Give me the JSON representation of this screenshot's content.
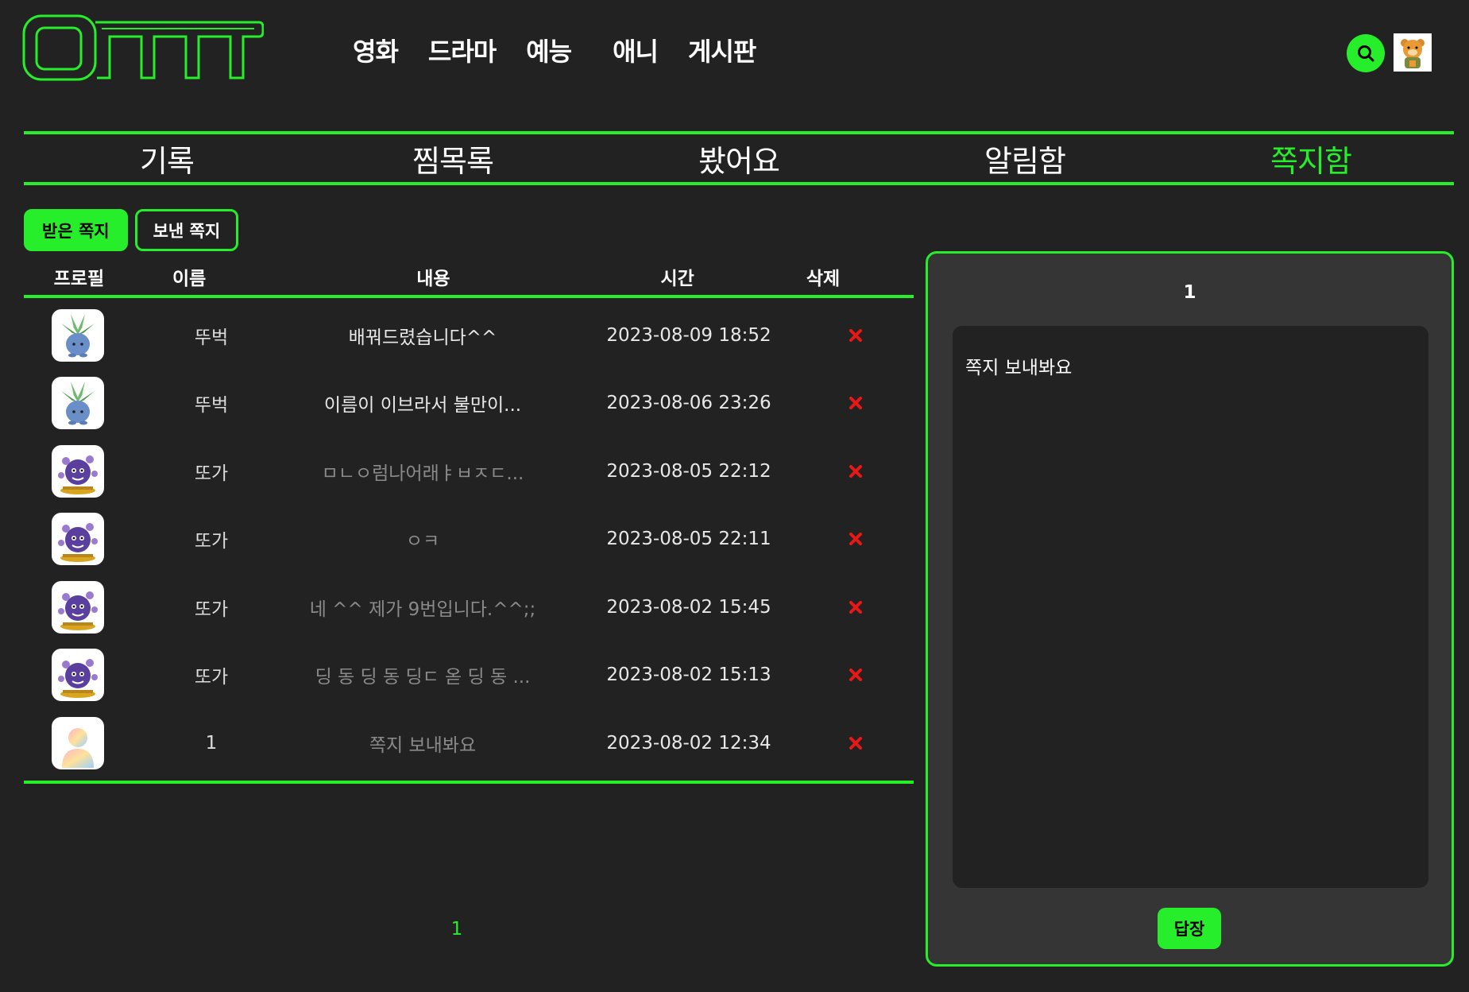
{
  "nav": {
    "items": [
      "영화",
      "드라마",
      "예능",
      "애니",
      "게시판"
    ]
  },
  "tabs": [
    {
      "label": "기록",
      "active": false
    },
    {
      "label": "찜목록",
      "active": false
    },
    {
      "label": "봤어요",
      "active": false
    },
    {
      "label": "알림함",
      "active": false
    },
    {
      "label": "쪽지함",
      "active": true
    }
  ],
  "subtabs": {
    "received": "받은 쪽지",
    "sent": "보낸 쪽지"
  },
  "table": {
    "headers": {
      "profile": "프로필",
      "name": "이름",
      "content": "내용",
      "time": "시간",
      "delete": "삭제"
    },
    "rows": [
      {
        "avatar": "plant-avatar",
        "name": "뚜벅",
        "content": "배꿔드렸습니다^^",
        "time": "2023-08-09 18:52",
        "read": false
      },
      {
        "avatar": "plant-avatar",
        "name": "뚜벅",
        "content": "이름이 이브라서 불만이...",
        "time": "2023-08-06 23:26",
        "read": false
      },
      {
        "avatar": "purple-avatar",
        "name": "또가",
        "content": "ㅁㄴㅇ럼나어래ㅑㅂㅈㄷ...",
        "time": "2023-08-05 22:12",
        "read": true
      },
      {
        "avatar": "purple-avatar",
        "name": "또가",
        "content": "ㅇㅋ",
        "time": "2023-08-05 22:11",
        "read": true
      },
      {
        "avatar": "purple-avatar",
        "name": "또가",
        "content": "네 ^^ 제가 9번입니다.^^;;",
        "time": "2023-08-02 15:45",
        "read": true
      },
      {
        "avatar": "purple-avatar",
        "name": "또가",
        "content": "딩 동 딩 동 딩ㄷ 옫 딩 동 ...",
        "time": "2023-08-02 15:13",
        "read": true
      },
      {
        "avatar": "default-avatar",
        "name": "1",
        "content": "쪽지 보내봐요",
        "time": "2023-08-02 12:34",
        "read": true
      }
    ]
  },
  "pagination": {
    "current": "1"
  },
  "panel": {
    "title": "1",
    "body": "쪽지 보내봐요",
    "reply_label": "답장"
  },
  "colors": {
    "accent": "#27ee2b",
    "background": "#222222",
    "panel": "#353535",
    "delete": "#e81818"
  }
}
